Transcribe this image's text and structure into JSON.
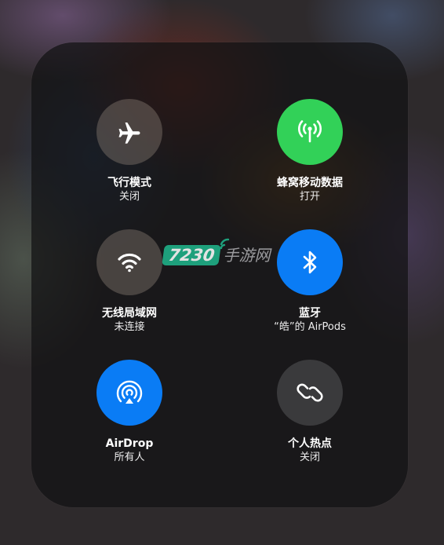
{
  "controls": [
    {
      "id": "airplane",
      "label": "飞行模式",
      "status": "关闭",
      "icon": "airplane-icon",
      "state": "off",
      "color": "#8a8074"
    },
    {
      "id": "cellular",
      "label": "蜂窝移动数据",
      "status": "打开",
      "icon": "cellular-antenna-icon",
      "state": "on",
      "color": "#32d158"
    },
    {
      "id": "wifi",
      "label": "无线局域网",
      "status": "未连接",
      "icon": "wifi-icon",
      "state": "off",
      "color": "#8a8074"
    },
    {
      "id": "bluetooth",
      "label": "蓝牙",
      "status": "“皓”的 AirPods",
      "icon": "bluetooth-icon",
      "state": "on",
      "color": "#0a7cf5"
    },
    {
      "id": "airdrop",
      "label": "AirDrop",
      "status": "所有人",
      "icon": "airdrop-icon",
      "state": "on",
      "color": "#0a7cf5"
    },
    {
      "id": "hotspot",
      "label": "个人热点",
      "status": "关闭",
      "icon": "hotspot-link-icon",
      "state": "off",
      "color": "#464648"
    }
  ],
  "watermark": {
    "number": "7230",
    "text": "手游网"
  }
}
